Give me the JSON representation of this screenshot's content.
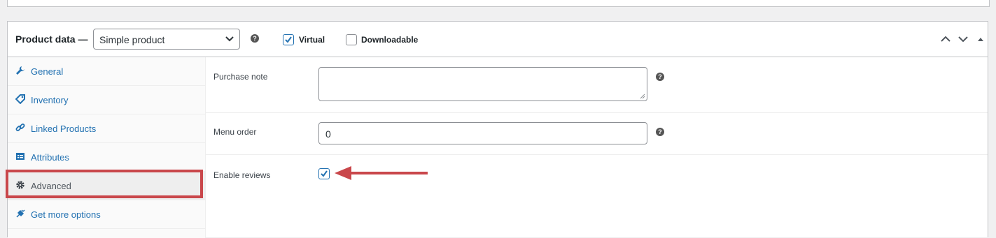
{
  "header": {
    "title": "Product data —",
    "product_type": {
      "selected": "Simple product"
    },
    "virtual": {
      "label": "Virtual",
      "checked": true
    },
    "downloadable": {
      "label": "Downloadable",
      "checked": false
    },
    "help_glyph": "?"
  },
  "tabs": [
    {
      "label": "General",
      "icon": "wrench-icon"
    },
    {
      "label": "Inventory",
      "icon": "tag-icon"
    },
    {
      "label": "Linked Products",
      "icon": "link-icon"
    },
    {
      "label": "Attributes",
      "icon": "list-icon"
    },
    {
      "label": "Advanced",
      "icon": "gear-icon",
      "active": true
    },
    {
      "label": "Get more options",
      "icon": "plugin-icon"
    }
  ],
  "fields": {
    "purchase_note": {
      "label": "Purchase note",
      "value": ""
    },
    "menu_order": {
      "label": "Menu order",
      "value": "0"
    },
    "enable_reviews": {
      "label": "Enable reviews",
      "checked": true
    }
  },
  "colors": {
    "accent": "#2271b1",
    "highlight": "#c9474b"
  }
}
